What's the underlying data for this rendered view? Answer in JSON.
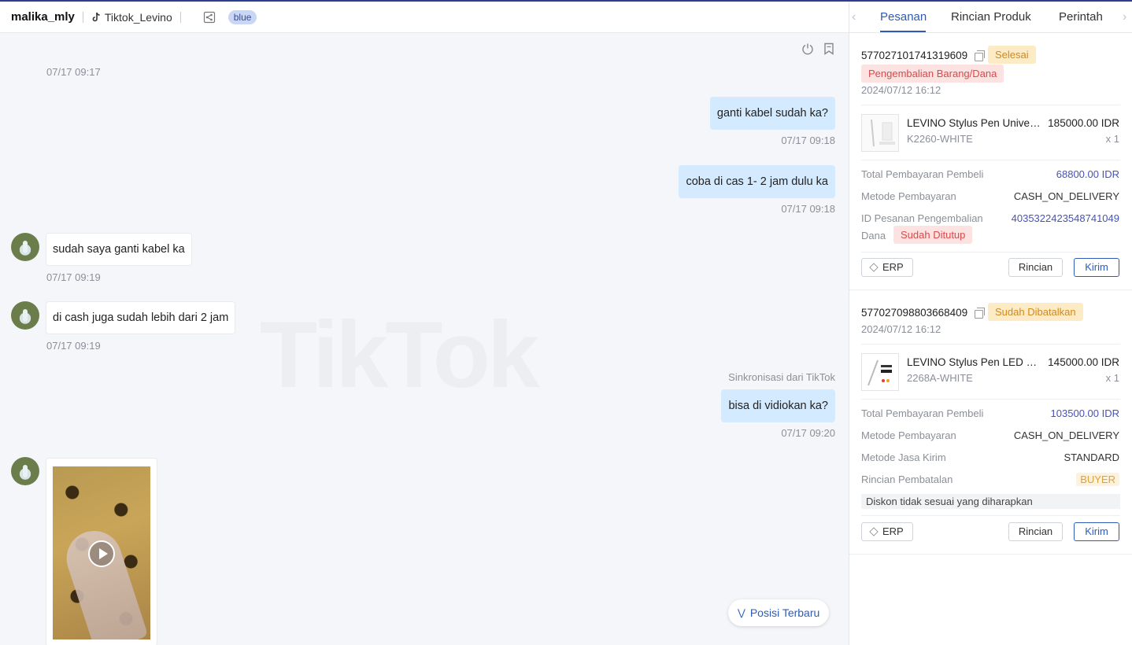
{
  "header": {
    "username": "malika_mly",
    "shop_name": "Tiktok_Levino",
    "tag": "blue"
  },
  "messages": [
    {
      "type": "time",
      "text": "07/17 09:17"
    },
    {
      "type": "out",
      "text": "ganti kabel sudah ka?",
      "time": "07/17 09:18"
    },
    {
      "type": "out",
      "text": "coba di cas 1- 2 jam dulu ka",
      "time": "07/17 09:18"
    },
    {
      "type": "in",
      "text": "sudah saya ganti kabel ka",
      "time": "07/17 09:19"
    },
    {
      "type": "in",
      "text": "di cash juga sudah lebih dari 2 jam",
      "time": "07/17 09:19"
    },
    {
      "type": "out",
      "text": "bisa di vidiokan ka?",
      "time": "07/17 09:20",
      "note": "Sinkronisasi dari TikTok"
    },
    {
      "type": "in-video"
    }
  ],
  "watermark": "TikTok",
  "latest_button": "Posisi Terbaru",
  "panel": {
    "tabs": [
      "Pesanan",
      "Rincian Produk",
      "Perintah"
    ],
    "active_tab": "Pesanan",
    "orders": [
      {
        "id": "577027101741319609",
        "status": "Selesai",
        "sub_status": "Pengembalian Barang/Dana",
        "date": "2024/07/12 16:12",
        "product": {
          "name": "LEVINO Stylus Pen Universal",
          "price": "185000.00 IDR",
          "sku": "K2260-WHITE",
          "qty": "x 1"
        },
        "fields": {
          "total_label": "Total Pembayaran Pembeli",
          "total_value": "68800.00 IDR",
          "method_label": "Metode Pembayaran",
          "method_value": "CASH_ON_DELIVERY",
          "refund_label_1": "ID Pesanan Pengembalian",
          "refund_label_2": "Dana",
          "refund_value": "4035322423548741049",
          "refund_status": "Sudah Ditutup"
        },
        "buttons": {
          "erp": "ERP",
          "detail": "Rincian",
          "send": "Kirim"
        }
      },
      {
        "id": "577027098803668409",
        "status": "Sudah Dibatalkan",
        "date": "2024/07/12 16:12",
        "product": {
          "name": "LEVINO Stylus Pen LED Pointer",
          "price": "145000.00 IDR",
          "sku": "2268A-WHITE",
          "qty": "x 1"
        },
        "fields": {
          "total_label": "Total Pembayaran Pembeli",
          "total_value": "103500.00 IDR",
          "method_label": "Metode Pembayaran",
          "method_value": "CASH_ON_DELIVERY",
          "ship_label": "Metode Jasa Kirim",
          "ship_value": "STANDARD",
          "cancel_label": "Rincian Pembatalan",
          "cancel_value": "BUYER",
          "cancel_reason": "Diskon tidak sesuai yang diharapkan"
        },
        "buttons": {
          "erp": "ERP",
          "detail": "Rincian",
          "send": "Kirim"
        }
      }
    ]
  },
  "colors": {
    "accent": "#2f5bb7",
    "bubble_out": "#d4eafe",
    "badge_yellow": "#fdebc6",
    "badge_red": "#fde2e2"
  }
}
